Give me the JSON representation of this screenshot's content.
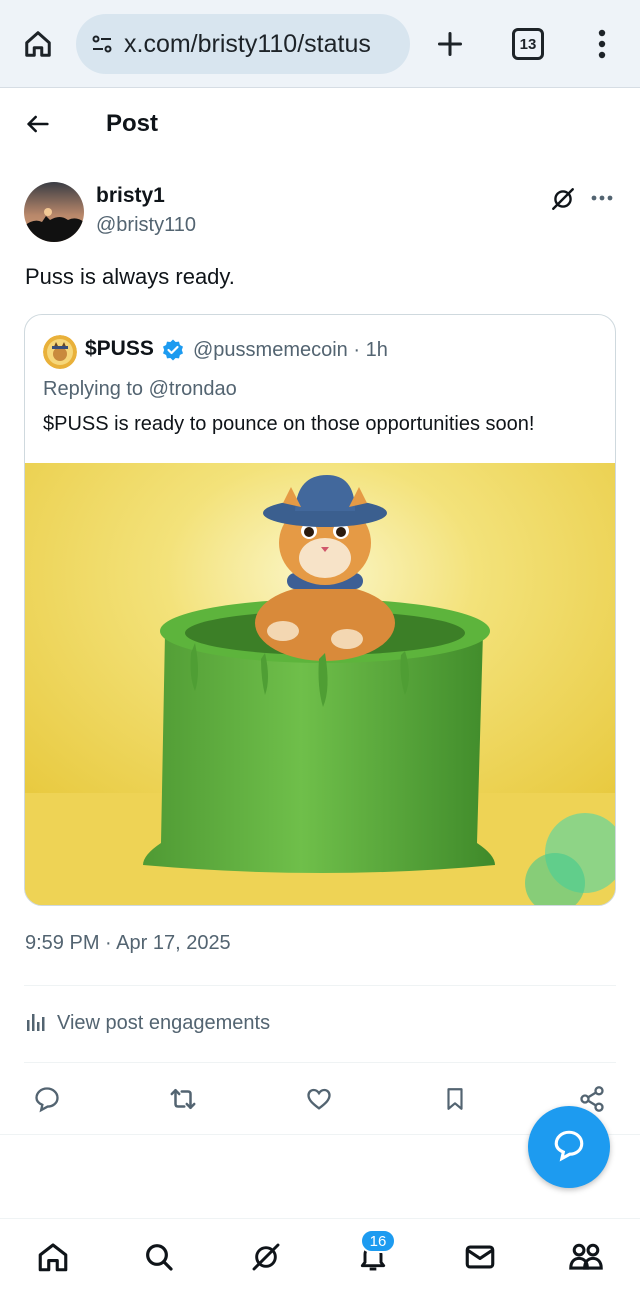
{
  "browser": {
    "url": "x.com/bristy110/status",
    "tab_count": "13",
    "icons": [
      "home-icon",
      "site-settings-icon",
      "new-tab-icon",
      "tabs-icon",
      "menu-icon"
    ]
  },
  "header": {
    "title": "Post",
    "back_icon": "arrow-left-icon"
  },
  "post": {
    "author_name": "bristy1",
    "author_handle": "@bristy110",
    "text": "Puss is always ready.",
    "timestamp": "9:59 PM · Apr 17, 2025",
    "engagements_label": "View post engagements"
  },
  "quote": {
    "name": "$PUSS",
    "handle_time": "@pussmemecoin · 1h",
    "replying_to": "Replying to @trondao",
    "text": "$PUSS is ready to pounce on those opportunities soon!",
    "image_desc_icon": "puss-cat-in-green-pot-image"
  },
  "actions": [
    "reply-icon",
    "repost-icon",
    "like-icon",
    "bookmark-icon",
    "share-icon"
  ],
  "bottom_nav": {
    "items": [
      "home-icon",
      "search-icon",
      "grok-icon",
      "notifications-icon",
      "messages-icon",
      "communities-icon"
    ],
    "notifications_badge": "16"
  },
  "colors": {
    "accent": "#1d9bf0",
    "muted": "#536471",
    "text": "#0f1419"
  }
}
